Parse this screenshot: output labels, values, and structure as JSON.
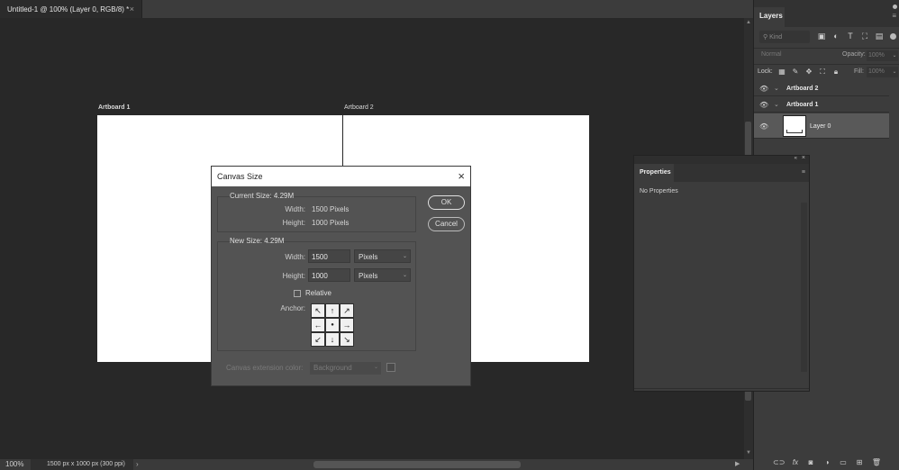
{
  "document": {
    "tab_title": "Untitled-1 @ 100% (Layer 0, RGB/8) *",
    "tab_close": "×"
  },
  "canvas": {
    "artboards": [
      {
        "label": "Artboard 1"
      },
      {
        "label": "Artboard 2"
      }
    ],
    "background_color": "#282828",
    "artboard_color": "#ffffff"
  },
  "status_bar": {
    "zoom": "100%",
    "doc_info": "1500 px x 1000 px (300 ppi)",
    "chevron": "›"
  },
  "layers_panel": {
    "tab_label": "Layers",
    "menu_icon": "≡",
    "filter": {
      "kind_placeholder": "Kind",
      "icons": [
        "image-filter-icon",
        "adjustment-filter-icon",
        "type-filter-icon",
        "shape-filter-icon",
        "smart-object-filter-icon"
      ]
    },
    "blend_mode": "Normal",
    "opacity_label": "Opacity:",
    "opacity_value": "100%",
    "lock_label": "Lock:",
    "fill_label": "Fill:",
    "fill_value": "100%",
    "layers": [
      {
        "name": "Artboard 2",
        "type": "artboard"
      },
      {
        "name": "Artboard 1",
        "type": "artboard"
      },
      {
        "name": "Layer 0",
        "type": "layer",
        "selected": true
      }
    ],
    "footer_icons": [
      "link-icon",
      "fx-icon",
      "mask-icon",
      "adjustment-icon",
      "folder-icon",
      "new-layer-icon",
      "trash-icon"
    ]
  },
  "properties_panel": {
    "tab_label": "Properties",
    "body": "No Properties",
    "menu_icon": "≡",
    "collapse": "«",
    "close": "×"
  },
  "dialog": {
    "title": "Canvas Size",
    "close": "×",
    "current_size": {
      "title": "Current Size: 4.29M",
      "width_label": "Width:",
      "width_value": "1500 Pixels",
      "height_label": "Height:",
      "height_value": "1000 Pixels"
    },
    "new_size": {
      "title": "New Size: 4.29M",
      "width_label": "Width:",
      "width_value": "1500",
      "width_unit": "Pixels",
      "height_label": "Height:",
      "height_value": "1000",
      "height_unit": "Pixels",
      "relative_label": "Relative",
      "relative_checked": false,
      "anchor_label": "Anchor:",
      "anchor_glyphs": [
        "↖",
        "↑",
        "↗",
        "←",
        "●",
        "→",
        "↙",
        "↓",
        "↘"
      ]
    },
    "extension": {
      "label": "Canvas extension color:",
      "value": "Background"
    },
    "ok_label": "OK",
    "cancel_label": "Cancel"
  }
}
